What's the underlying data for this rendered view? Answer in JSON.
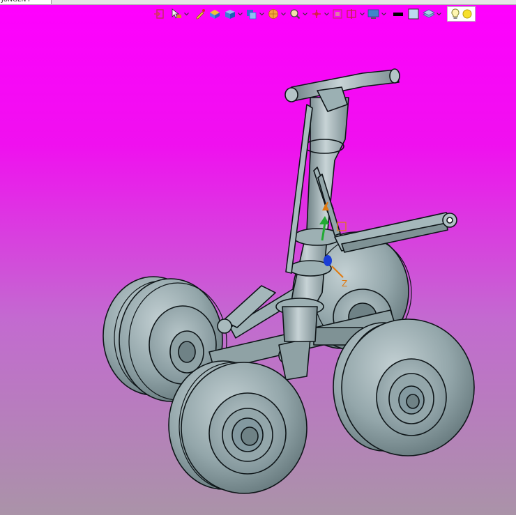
{
  "window": {
    "tab_title": "JUNGEN F"
  },
  "toolbar": {
    "buttons": [
      {
        "id": "exit-sketch",
        "icon": "exit-icon",
        "dropdown": false
      },
      {
        "id": "select-filter",
        "icon": "cursor-filter-icon",
        "dropdown": true
      },
      {
        "id": "snap-point",
        "icon": "pencil-point-icon",
        "dropdown": false
      },
      {
        "id": "measure",
        "icon": "part-measure-icon",
        "dropdown": false
      },
      {
        "id": "view-cube",
        "icon": "cube-view-icon",
        "dropdown": true
      },
      {
        "id": "display-style",
        "icon": "shaded-display-icon",
        "dropdown": true
      },
      {
        "id": "render-style",
        "icon": "render-sphere-icon",
        "dropdown": true
      },
      {
        "id": "zoom",
        "icon": "zoom-icon",
        "dropdown": true
      },
      {
        "id": "axis-triad",
        "icon": "axis-triad-icon",
        "dropdown": true
      },
      {
        "id": "fit-frame",
        "icon": "fit-frame-icon",
        "dropdown": false
      },
      {
        "id": "section-view",
        "icon": "section-view-icon",
        "dropdown": true
      },
      {
        "id": "screen-capture",
        "icon": "monitor-icon",
        "dropdown": true
      },
      {
        "id": "edge-color",
        "icon": "black-swatch-icon",
        "dropdown": false
      },
      {
        "id": "background-color",
        "icon": "light-blue-swatch-icon",
        "dropdown": false
      },
      {
        "id": "layers",
        "icon": "layers-icon",
        "dropdown": true
      }
    ],
    "light_controls": [
      "lightbulb-icon",
      "yellow-light-icon"
    ]
  },
  "model": {
    "name": "landing-gear-assembly",
    "triad_axis_label": "Z"
  },
  "colors": {
    "bg_top": "#ff00ff",
    "bg_bottom": "#aa93a8",
    "model_fill": "#8fa2a5",
    "model_edge": "#0e1518",
    "triad_orange": "#e07a10",
    "triad_green": "#22aa33",
    "triad_blue": "#1a3dd6"
  }
}
